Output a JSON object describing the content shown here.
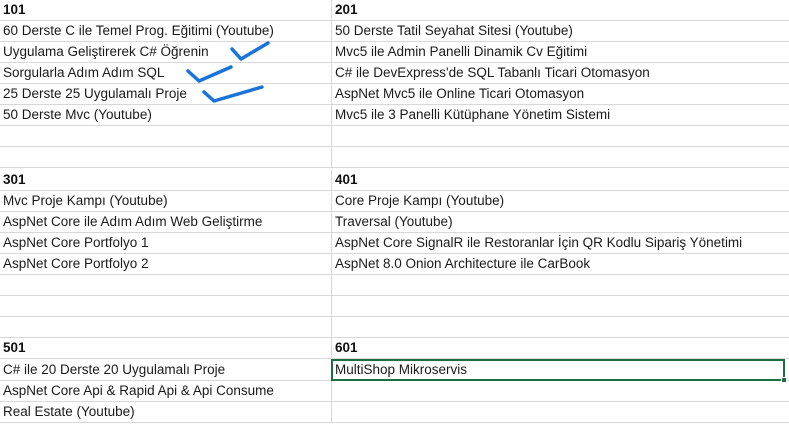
{
  "accent_color": "#1e6e42",
  "annotation_color": "#1a73d9",
  "sheet": {
    "r1": {
      "a": "101",
      "b": "201"
    },
    "r2": {
      "a": "60 Derste C ile Temel Prog. Eğitimi (Youtube)",
      "b": "50 Derste Tatil Seyahat Sitesi (Youtube)"
    },
    "r3": {
      "a": "Uygulama Geliştirerek C# Öğrenin",
      "b": "Mvc5 ile Admin Panelli Dinamik Cv Eğitimi"
    },
    "r4": {
      "a": "Sorgularla Adım Adım SQL",
      "b": "C# ile DevExpress'de SQL Tabanlı Ticari Otomasyon"
    },
    "r5": {
      "a": "25 Derste 25 Uygulamalı Proje",
      "b": "AspNet Mvc5 ile Online Ticari Otomasyon"
    },
    "r6": {
      "a": "50 Derste Mvc (Youtube)",
      "b": "Mvc5 ile 3 Panelli Kütüphane Yönetim Sistemi"
    },
    "r7": {
      "a": "",
      "b": ""
    },
    "r8": {
      "a": "",
      "b": ""
    },
    "r9": {
      "a": "301",
      "b": "401"
    },
    "r10": {
      "a": "Mvc Proje Kampı (Youtube)",
      "b": "Core Proje Kampı (Youtube)"
    },
    "r11": {
      "a": "AspNet Core ile Adım Adım Web Geliştirme",
      "b": "Traversal (Youtube)"
    },
    "r12": {
      "a": "AspNet Core Portfolyo 1",
      "b": "AspNet Core SignalR ile Restoranlar İçin QR Kodlu Sipariş Yönetimi"
    },
    "r13": {
      "a": "AspNet Core Portfolyo 2",
      "b": "AspNet 8.0 Onion Architecture ile CarBook"
    },
    "r14": {
      "a": "",
      "b": ""
    },
    "r15": {
      "a": "",
      "b": ""
    },
    "r16": {
      "a": "",
      "b": ""
    },
    "r17": {
      "a": "501",
      "b": "601"
    },
    "r18": {
      "a": "C# ile 20 Derste 20 Uygulamalı Proje",
      "b": "MultiShop Mikroservis"
    },
    "r19": {
      "a": "AspNet Core Api & Rapid Api & Api Consume",
      "b": ""
    },
    "r20": {
      "a": "Real Estate (Youtube)",
      "b": ""
    }
  }
}
